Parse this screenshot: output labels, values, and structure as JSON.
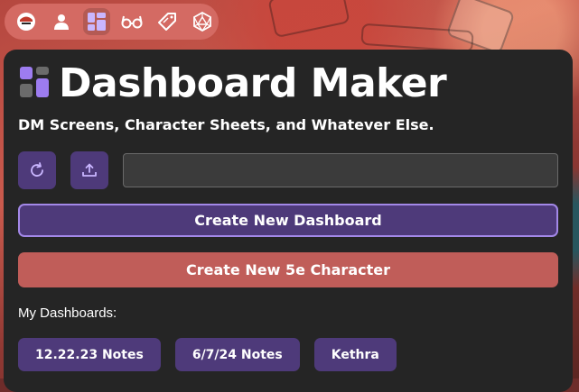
{
  "nav": {
    "items": [
      {
        "icon": "helmet-icon"
      },
      {
        "icon": "user-icon"
      },
      {
        "icon": "dashboard-icon"
      },
      {
        "icon": "glasses-icon"
      },
      {
        "icon": "tag-icon"
      },
      {
        "icon": "d20-icon"
      }
    ]
  },
  "header": {
    "title": "Dashboard Maker",
    "subtitle": "DM Screens, Character Sheets, and Whatever Else."
  },
  "toolbar": {
    "refresh_icon": "refresh-icon",
    "upload_icon": "upload-icon",
    "input_value": ""
  },
  "actions": {
    "create_dashboard": "Create New Dashboard",
    "create_character": "Create New 5e Character"
  },
  "dashboards": {
    "label": "My Dashboards:",
    "items": [
      "12.22.23 Notes",
      "6/7/24 Notes",
      "Kethra"
    ]
  },
  "colors": {
    "panel": "#252525",
    "accent_purple": "#4e3a7a",
    "accent_border": "#a388e8",
    "accent_red": "#c05d59",
    "nav_pill": "#d46a63",
    "logo_purple": "#9d7cf0"
  }
}
